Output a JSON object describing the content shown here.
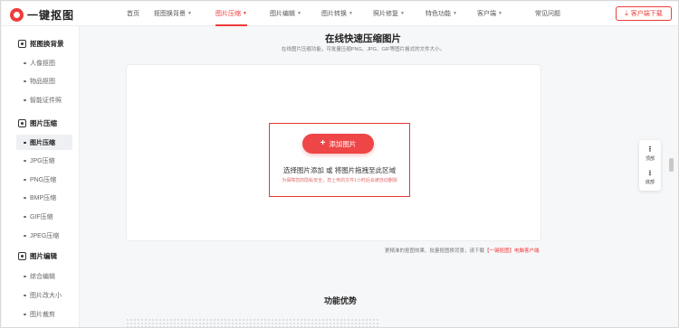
{
  "brand": {
    "name": "一键抠图",
    "accent": "#ee3b3b"
  },
  "nav": {
    "items": [
      {
        "label": "首页",
        "caret": false,
        "active": false
      },
      {
        "label": "抠图换背景",
        "caret": true,
        "active": false
      },
      {
        "label": "图片压缩",
        "caret": true,
        "active": true
      },
      {
        "label": "图片编辑",
        "caret": true,
        "active": false
      },
      {
        "label": "图片转换",
        "caret": true,
        "active": false
      },
      {
        "label": "照片修复",
        "caret": true,
        "active": false
      },
      {
        "label": "特色功能",
        "caret": true,
        "active": false
      },
      {
        "label": "客户端",
        "caret": true,
        "active": false
      },
      {
        "label": "常见问题",
        "caret": false,
        "active": false
      }
    ],
    "download_label": "客户端下载",
    "download_icon": "download-icon"
  },
  "sidebar": {
    "groups": [
      {
        "title": "抠图换背景",
        "icon": "cutout-icon",
        "items": [
          "人像抠图",
          "物品抠图",
          "智能证件照"
        ]
      },
      {
        "title": "图片压缩",
        "icon": "compress-icon",
        "items": [
          "图片压缩",
          "JPG压缩",
          "PNG压缩",
          "BMP压缩",
          "GIF压缩",
          "JPEG压缩"
        ]
      },
      {
        "title": "图片编辑",
        "icon": "edit-icon",
        "items": [
          "综合编辑",
          "图片改大小",
          "图片裁剪"
        ]
      }
    ],
    "active_item": "图片压缩"
  },
  "main": {
    "title": "在线快速压缩图片",
    "subtitle": "在线图片压缩功能，可批量压缩PNG、JPG、GIF等图片格式的文件大小。",
    "add_button": "添加图片",
    "drop_hint": "选择图片添加 或 将图片拖拽至此区域",
    "privacy": "为保障您的隐私安全，您上传的文件1小时后会被自动删除",
    "footer_text": "更精准的抠图效果、批量抠图换背景，请下载",
    "footer_link": "【一键抠图】电脑客户端",
    "section_title": "功能优势"
  },
  "float_tools": {
    "top_label": "顶部",
    "bottom_label": "底部"
  }
}
